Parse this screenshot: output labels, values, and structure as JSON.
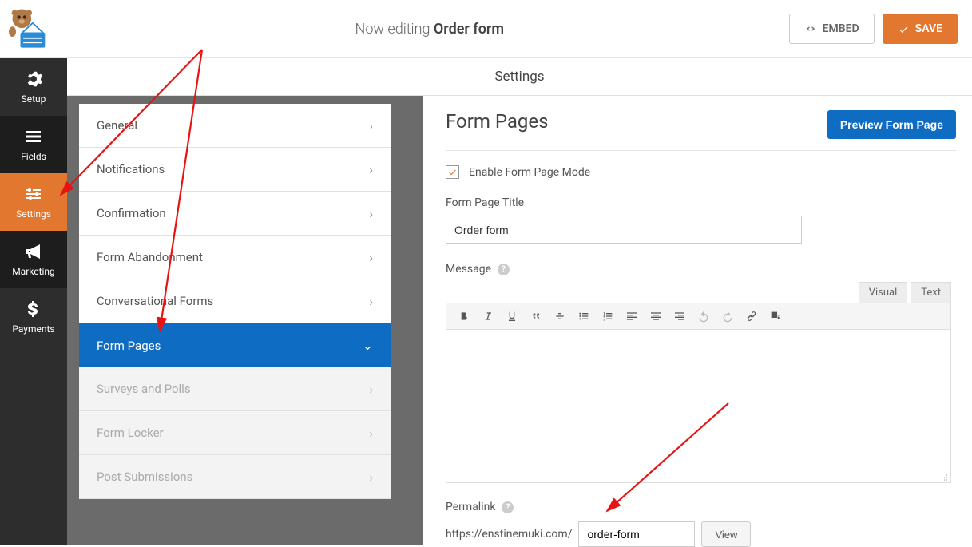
{
  "header": {
    "prefix": "Now editing",
    "form_name": "Order form",
    "embed_label": "EMBED",
    "save_label": "SAVE"
  },
  "settings_bar_title": "Settings",
  "sidebar_icons": {
    "setup": "Setup",
    "fields": "Fields",
    "settings": "Settings",
    "marketing": "Marketing",
    "payments": "Payments"
  },
  "settings_panel": {
    "items": [
      {
        "label": "General",
        "state": "normal"
      },
      {
        "label": "Notifications",
        "state": "normal"
      },
      {
        "label": "Confirmation",
        "state": "normal"
      },
      {
        "label": "Form Abandonment",
        "state": "normal"
      },
      {
        "label": "Conversational Forms",
        "state": "normal"
      },
      {
        "label": "Form Pages",
        "state": "selected"
      },
      {
        "label": "Surveys and Polls",
        "state": "disabled"
      },
      {
        "label": "Form Locker",
        "state": "disabled"
      },
      {
        "label": "Post Submissions",
        "state": "disabled"
      }
    ]
  },
  "form_pages": {
    "heading": "Form Pages",
    "preview_btn": "Preview Form Page",
    "enable_label": "Enable Form Page Mode",
    "enable_checked": true,
    "title_label": "Form Page Title",
    "title_value": "Order form",
    "message_label": "Message",
    "editor_tabs": {
      "visual": "Visual",
      "text": "Text"
    },
    "permalink_label": "Permalink",
    "permalink_prefix": "https://enstinemuki.com/",
    "permalink_slug": "order-form",
    "view_btn": "View"
  }
}
